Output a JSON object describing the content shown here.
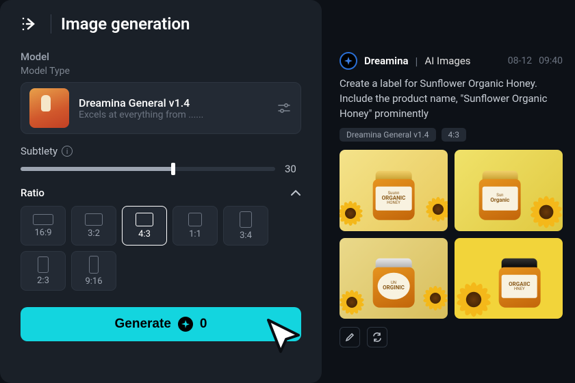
{
  "header": {
    "title": "Image generation"
  },
  "model": {
    "section_label": "Model",
    "type_label": "Model Type",
    "name": "Dreamina General v1.4",
    "desc": "Excels at everything from ......"
  },
  "subtlety": {
    "label": "Subtlety",
    "value": "30"
  },
  "ratio": {
    "label": "Ratio",
    "selected": "4:3",
    "options": [
      "16:9",
      "3:2",
      "4:3",
      "1:1",
      "3:4",
      "2:3",
      "9:16"
    ]
  },
  "generate": {
    "label": "Generate",
    "cost": "0"
  },
  "feed": {
    "brand": "Dreamina",
    "category": "AI Images",
    "date": "08-12",
    "time": "09:40",
    "prompt": "Create a label for Sunflower Organic Honey. Include the product name, \"Sunflower Organic Honey\" prominently",
    "chips": [
      "Dreamina General v1.4",
      "4:3"
    ],
    "labels": {
      "a": {
        "top": "Suunn",
        "mid": "ORGANIC",
        "bot": "HONEY"
      },
      "b": {
        "top": "Sun",
        "mid": "Organic",
        "bot": ""
      },
      "c": {
        "top": "UN",
        "mid": "ORGINIC",
        "bot": ""
      },
      "d": {
        "top": "ORGAIIC",
        "mid": "HNEY",
        "bot": ""
      }
    }
  }
}
